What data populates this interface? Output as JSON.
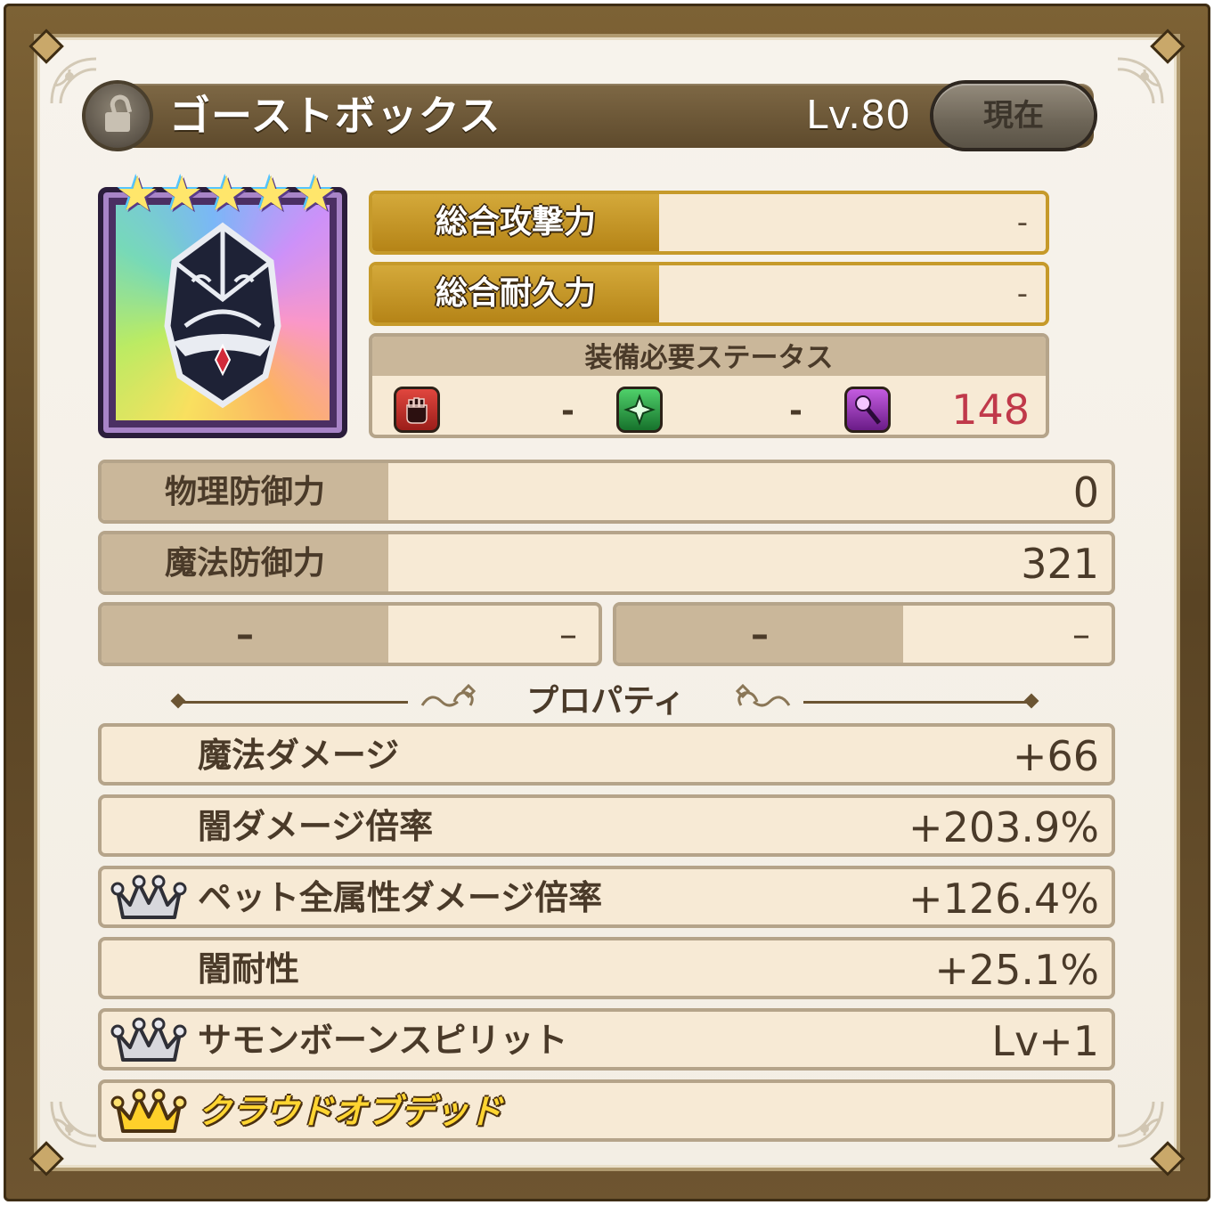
{
  "header": {
    "item_name": "ゴーストボックス",
    "level": "Lv.80",
    "current_button": "現在"
  },
  "item": {
    "rarity_stars": 5,
    "icon": "ghost-box-icon"
  },
  "totals": {
    "attack_label": "総合攻撃力",
    "attack_value": "-",
    "durability_label": "総合耐久力",
    "durability_value": "-"
  },
  "requirements": {
    "title": "装備必要ステータス",
    "strength_icon": "fist-icon",
    "strength_value": "-",
    "dexterity_icon": "star-sparkle-icon",
    "dexterity_value": "-",
    "intelligence_icon": "staff-icon",
    "intelligence_value": "148",
    "intelligence_color": "#c0394a"
  },
  "stats": {
    "phys_def_label": "物理防御力",
    "phys_def_value": "0",
    "mag_def_label": "魔法防御力",
    "mag_def_value": "321",
    "extra1_label": "–",
    "extra1_value": "–",
    "extra2_label": "–",
    "extra2_value": "–"
  },
  "properties": {
    "title": "プロパティ",
    "items": [
      {
        "label": "魔法ダメージ",
        "value": "+66",
        "crown": "none"
      },
      {
        "label": "闇ダメージ倍率",
        "value": "+203.9%",
        "crown": "none"
      },
      {
        "label": "ペット全属性ダメージ倍率",
        "value": "+126.4%",
        "crown": "silver"
      },
      {
        "label": "闇耐性",
        "value": "+25.1%",
        "crown": "none"
      },
      {
        "label": "サモンボーンスピリット",
        "value": "Lv+1",
        "crown": "silver"
      },
      {
        "label": "クラウドオブデッド",
        "value": "",
        "crown": "gold"
      }
    ]
  },
  "colors": {
    "frame": "#5e4a2c",
    "panel": "#f7ead5",
    "gold_label": "#c69a2a",
    "req_highlight": "#c0394a"
  }
}
